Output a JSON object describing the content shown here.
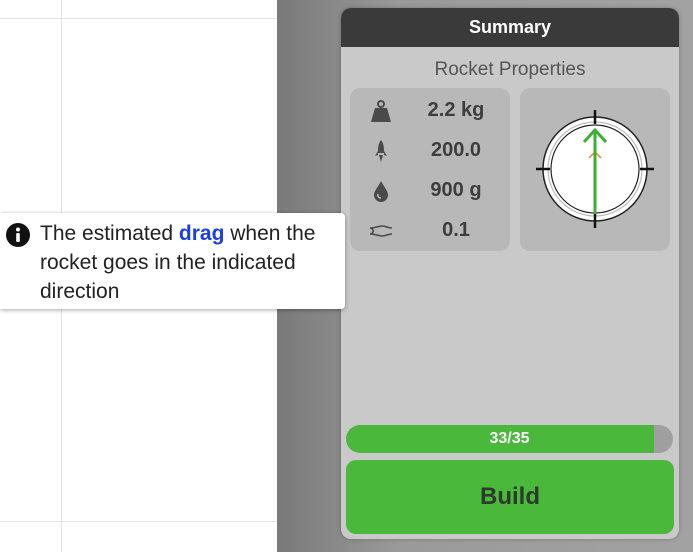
{
  "panel": {
    "title": "Summary",
    "subtitle": "Rocket Properties"
  },
  "properties": [
    {
      "icon": "weight-icon",
      "value": "2.2 kg"
    },
    {
      "icon": "rocket-thrust-icon",
      "value": "200.0"
    },
    {
      "icon": "fuel-drop-icon",
      "value": "900 g"
    },
    {
      "icon": "drag-airflow-icon",
      "value": "0.1"
    }
  ],
  "direction_indicator": {
    "icon": "direction-compass-icon",
    "arrow_colors": {
      "primary": "#3cb033",
      "secondary": "#e8905a"
    }
  },
  "progress": {
    "text": "33/35",
    "current": 33,
    "max": 35
  },
  "build_button": {
    "label": "Build"
  },
  "tooltip": {
    "icon": "info-icon",
    "text_before": "The estimated ",
    "keyword": "drag",
    "text_after": " when the rocket goes in the indicated direction"
  },
  "colors": {
    "accent_green": "#4ab83a",
    "keyword_blue": "#1a3fe0",
    "header_dark": "#3a3a3a"
  }
}
